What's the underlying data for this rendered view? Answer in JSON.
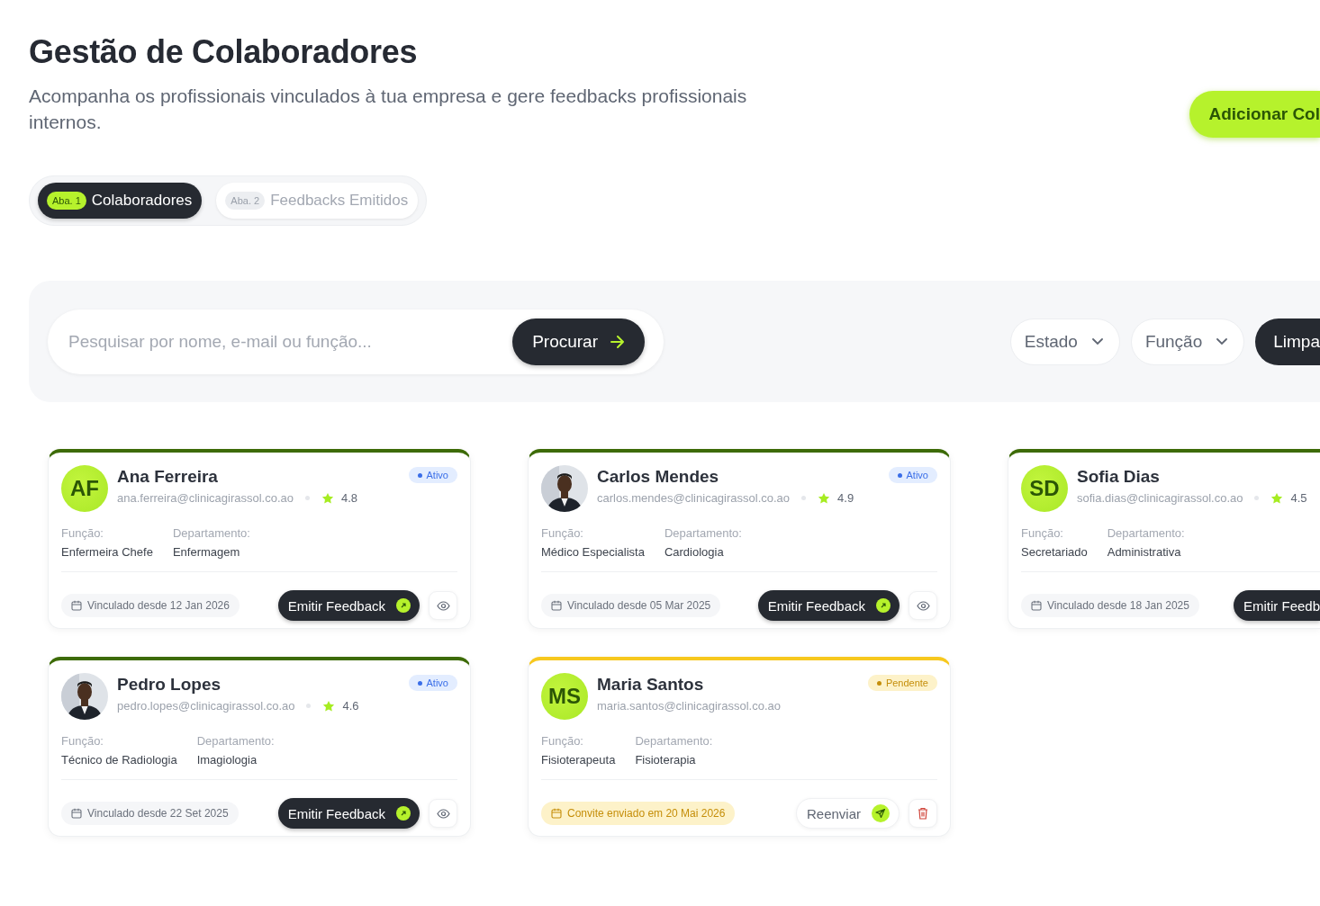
{
  "header": {
    "title": "Gestão de Colaboradores",
    "subtitle": "Acompanha os profissionais vinculados à tua empresa e gere feedbacks profissionais internos.",
    "add_button": "Adicionar Col"
  },
  "tabs": [
    {
      "badge": "Aba. 1",
      "label": "Colaboradores",
      "selected": true
    },
    {
      "badge": "Aba. 2",
      "label": "Feedbacks Emitidos",
      "selected": false
    }
  ],
  "filters": {
    "search": {
      "placeholder": "Pesquisar por nome, e-mail ou função..."
    },
    "search_button": "Procurar",
    "dropdowns": [
      "Estado",
      "Função"
    ],
    "clear_button": "Limpa"
  },
  "cards": [
    {
      "name": "Ana Ferreira",
      "email": "ana.ferreira@clinicagirassol.co.ao",
      "rating": "4.8",
      "status": {
        "label": "Ativo",
        "kind": "active"
      },
      "color": "#3d6b07",
      "avatar": {
        "kind": "initials",
        "text": "AF"
      },
      "fields": [
        {
          "label": "Função:",
          "value": "Enfermeira Chefe"
        },
        {
          "label": "Departamento:",
          "value": "Enfermagem"
        }
      ],
      "footer": {
        "kind": "linked",
        "text": "Vinculado desde 12 Jan 2026"
      },
      "actions": [
        {
          "kind": "feedback",
          "label": "Emitir Feedback"
        },
        {
          "kind": "view"
        }
      ]
    },
    {
      "name": "Carlos Mendes",
      "email": "carlos.mendes@clinicagirassol.co.ao",
      "rating": "4.9",
      "status": {
        "label": "Ativo",
        "kind": "active"
      },
      "color": "#3d6b07",
      "fields": [
        {
          "label": "Função:",
          "value": "Médico Especialista"
        },
        {
          "label": "Departamento:",
          "value": "Cardiologia"
        }
      ],
      "footer": {
        "kind": "linked",
        "text": "Vinculado desde 05 Mar 2025"
      },
      "actions": [
        {
          "kind": "feedback",
          "label": "Emitir Feedback"
        },
        {
          "kind": "view"
        }
      ]
    },
    {
      "name": "Sofia Dias",
      "email": "sofia.dias@clinicagirassol.co.ao",
      "rating": "4.5",
      "color": "#3d6b07",
      "avatar": {
        "kind": "initials",
        "text": "SD"
      },
      "fields": [
        {
          "label": "Função:",
          "value": "Secretariado"
        },
        {
          "label": "Departamento:",
          "value": "Administrativa"
        }
      ],
      "footer": {
        "kind": "linked",
        "text": "Vinculado desde 18 Jan 2025"
      },
      "actions": [
        {
          "kind": "feedback",
          "label": "Emitir Feedb"
        }
      ]
    },
    {
      "name": "Pedro Lopes",
      "email": "pedro.lopes@clinicagirassol.co.ao",
      "rating": "4.6",
      "status": {
        "label": "Ativo",
        "kind": "active"
      },
      "color": "#3d6b07",
      "fields": [
        {
          "label": "Função:",
          "value": "Técnico de Radiologia"
        },
        {
          "label": "Departamento:",
          "value": "Imagiologia"
        }
      ],
      "footer": {
        "kind": "linked",
        "text": "Vinculado desde 22 Set 2025"
      },
      "actions": [
        {
          "kind": "feedback",
          "label": "Emitir Feedback"
        },
        {
          "kind": "view"
        }
      ]
    },
    {
      "name": "Maria Santos",
      "email": "maria.santos@clinicagirassol.co.ao",
      "status": {
        "label": "Pendente",
        "kind": "pending"
      },
      "color": "#f7c81e",
      "avatar": {
        "kind": "initials",
        "text": "MS"
      },
      "fields": [
        {
          "label": "Função:",
          "value": "Fisioterapeuta"
        },
        {
          "label": "Departamento:",
          "value": "Fisioterapia"
        }
      ],
      "footer": {
        "kind": "invite",
        "text": "Convite enviado em 20 Mai 2026"
      },
      "actions": [
        {
          "kind": "resend",
          "label": "Reenviar"
        },
        {
          "kind": "delete"
        }
      ]
    }
  ]
}
